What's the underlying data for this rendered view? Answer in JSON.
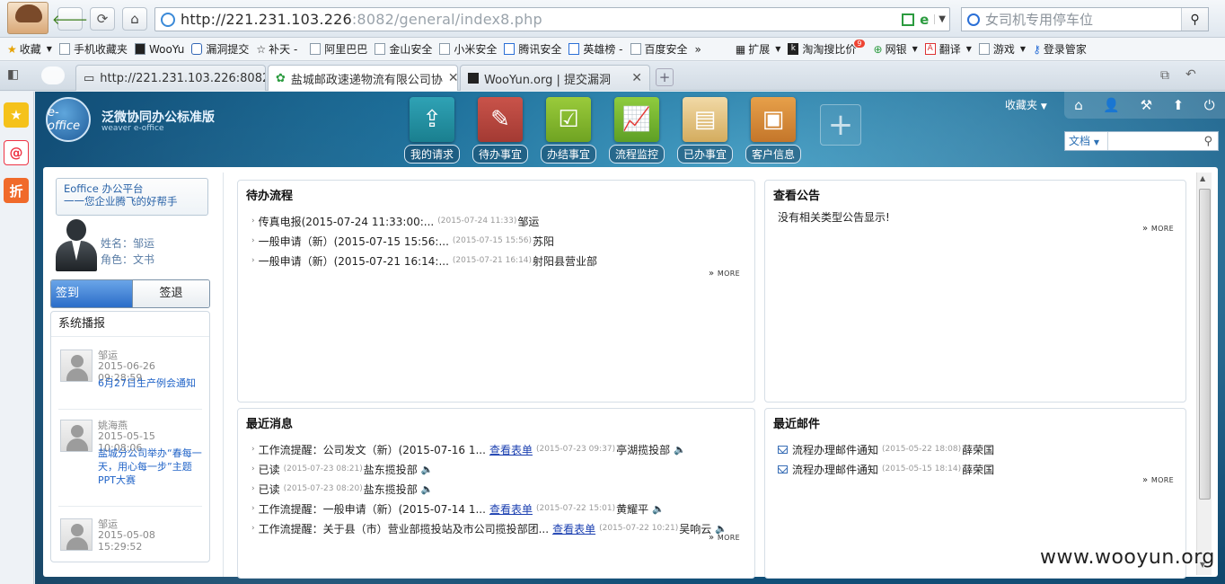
{
  "browser": {
    "url_host": "http://221.231.103.226",
    "url_rest": ":8082/general/index8.php",
    "search_placeholder": "女司机专用停车位",
    "favorites": [
      "收藏",
      "手机收藏夹",
      "WooYu",
      "漏洞提交",
      "补天 -",
      "阿里巴巴",
      "金山安全",
      "小米安全",
      "腾讯安全",
      "英雄榜 -",
      "百度安全",
      "»",
      "扩展",
      "淘淘搜比价",
      "网银",
      "翻译",
      "游戏",
      "登录管家"
    ],
    "tabs": [
      {
        "title": "http://221.231.103.226:8082"
      },
      {
        "title": "盐城邮政速递物流有限公司协"
      },
      {
        "title": "WooYun.org | 提交漏洞"
      }
    ],
    "badge_9": "9"
  },
  "app": {
    "logo_text": "e-office",
    "title": "泛微协同办公标准版",
    "subtitle": "weaver e-office",
    "modules": [
      "我的请求",
      "待办事宜",
      "办结事宜",
      "流程监控",
      "已办事宜",
      "客户信息"
    ],
    "user_menu": "收藏夹",
    "search_type": "文档",
    "strip_icons": [
      "★",
      "@",
      "折"
    ]
  },
  "sidebar": {
    "slogan_line1": "Eoffice 办公平台",
    "slogan_line2": "一一您企业腾飞的好帮手",
    "name": "姓名：邹运",
    "role": "角色：文书",
    "sign_in": "签到",
    "sign_out": "签退",
    "news_title": "系统播报",
    "news": [
      {
        "name": "邹运",
        "time": "2015-06-26 09:28:59",
        "title": "6月27日生产例会通知"
      },
      {
        "name": "姚海燕",
        "time": "2015-05-15 10:08:06",
        "title": "盐城分公司举办“春每一天，用心每一步”主题PPT大赛"
      },
      {
        "name": "邹运",
        "time": "2015-05-08 15:29:52",
        "title": ""
      }
    ]
  },
  "panels": {
    "todo": {
      "title": "待办流程",
      "rows": [
        {
          "text": "传真电报(2015-07-24 11:33:00:...",
          "date": "(2015-07-24 11:33)",
          "who": "邹运"
        },
        {
          "text": "一般申请（新）(2015-07-15 15:56:...",
          "date": "(2015-07-15 15:56)",
          "who": "苏阳"
        },
        {
          "text": "一般申请（新）(2015-07-21 16:14:...",
          "date": "(2015-07-21 16:14)",
          "who": "射阳县营业部"
        }
      ],
      "more": "MORE"
    },
    "notice": {
      "title": "查看公告",
      "empty": "没有相关类型公告显示!",
      "more": "MORE"
    },
    "messages": {
      "title": "最近消息",
      "rows": [
        {
          "text": "工作流提醒：公司发文（新）(2015-07-16 1...",
          "link": "查看表单",
          "date": "(2015-07-23 09:37)",
          "who": "亭湖揽投部"
        },
        {
          "text": "已读",
          "link": "",
          "date": "(2015-07-23 08:21)",
          "who": "盐东揽投部"
        },
        {
          "text": "已读",
          "link": "",
          "date": "(2015-07-23 08:20)",
          "who": "盐东揽投部"
        },
        {
          "text": "工作流提醒：一般申请（新）(2015-07-14 1...",
          "link": "查看表单",
          "date": "(2015-07-22 15:01)",
          "who": "黄耀平"
        },
        {
          "text": "工作流提醒：关于县（市）营业部揽投站及市公司揽投部团...",
          "link": "查看表单",
          "date": "(2015-07-22 10:21)",
          "who": "吴响云"
        }
      ],
      "more": "MORE"
    },
    "mail": {
      "title": "最近邮件",
      "rows": [
        {
          "text": "流程办理邮件通知",
          "date": "(2015-05-22 18:08)",
          "who": "薛荣国"
        },
        {
          "text": "流程办理邮件通知",
          "date": "(2015-05-15 18:14)",
          "who": "薛荣国"
        }
      ],
      "more": "MORE"
    }
  },
  "watermark": "www.wooyun.org"
}
